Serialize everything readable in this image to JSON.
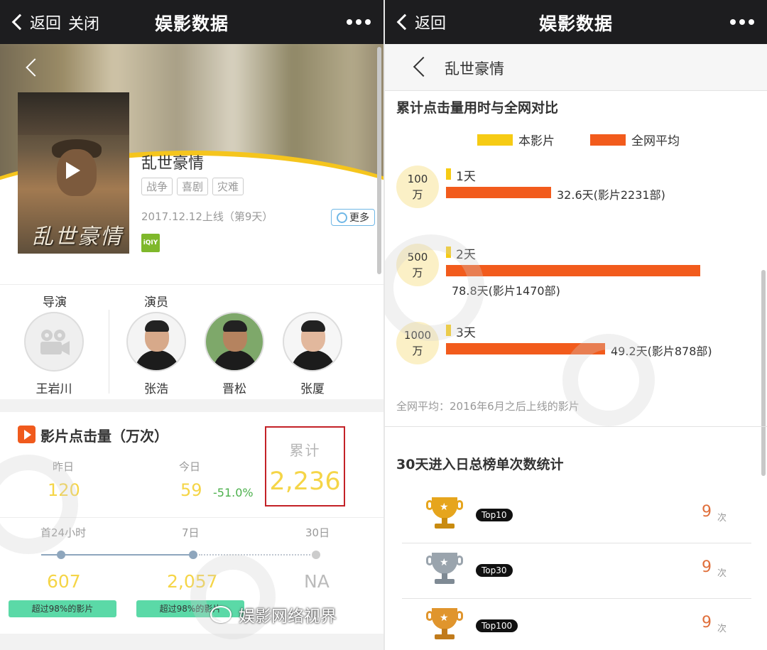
{
  "left_nav": {
    "back": "返回",
    "close": "关闭",
    "title": "娱影数据"
  },
  "right_nav": {
    "back": "返回",
    "title": "娱影数据"
  },
  "movie": {
    "title": "乱世豪情",
    "poster_title": "乱世豪情",
    "tags": [
      "战争",
      "喜剧",
      "灾难"
    ],
    "release": "2017.12.12上线（第9天）",
    "more": "更多",
    "platform_logo": "iQIY"
  },
  "cast": {
    "director_label": "导演",
    "actor_label": "演员",
    "director": {
      "name": "王岩川"
    },
    "actors": [
      {
        "name": "张浩"
      },
      {
        "name": "晋松"
      },
      {
        "name": "张厦"
      }
    ]
  },
  "clicks": {
    "title": "影片点击量（万次）",
    "yesterday_label": "昨日",
    "yesterday_value": "120",
    "today_label": "今日",
    "today_value": "59",
    "change": "-51.0%",
    "cumulative_label": "累计",
    "cumulative_value": "2,236",
    "periods": [
      {
        "label": "首24小时",
        "value": "607",
        "badge": "超过98%的影片"
      },
      {
        "label": "7日",
        "value": "2,057",
        "badge": "超过98%的影片"
      },
      {
        "label": "30日",
        "value": "NA"
      }
    ]
  },
  "detail": {
    "title": "乱世豪情",
    "comparison_title": "累计点击量用时与全网对比",
    "legend": {
      "this": "本影片",
      "avg": "全网平均"
    },
    "colors": {
      "this": "#f6cb14",
      "avg": "#f25b1c"
    },
    "milestones": [
      {
        "line1": "100",
        "line2": "万",
        "this_days": 1,
        "this_label": "1天",
        "avg_days": 32.6,
        "avg_label": "32.6天(影片2231部)"
      },
      {
        "line1": "500",
        "line2": "万",
        "this_days": 2,
        "this_label": "2天",
        "avg_days": 78.8,
        "avg_label": "78.8天(影片1470部)"
      },
      {
        "line1": "1000",
        "line2": "万",
        "this_days": 3,
        "this_label": "3天",
        "avg_days": 49.2,
        "avg_label": "49.2天(影片878部)"
      }
    ],
    "note": "全网平均：2016年6月之后上线的影片",
    "ranking_title": "30天进入日总榜单次数统计",
    "ranking": [
      {
        "label": "Top10",
        "count": "9",
        "unit": "次"
      },
      {
        "label": "Top30",
        "count": "9",
        "unit": "次"
      },
      {
        "label": "Top100",
        "count": "9",
        "unit": "次"
      }
    ]
  },
  "watermark": "娱影网络视界"
}
